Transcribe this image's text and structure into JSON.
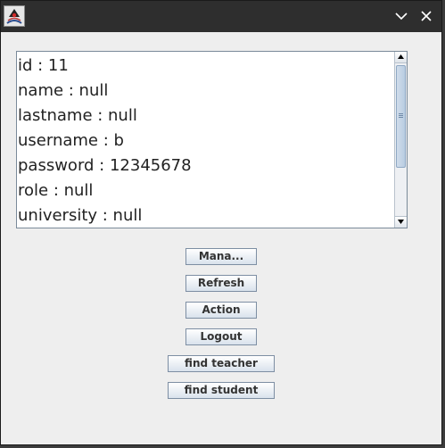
{
  "window": {
    "icons": {
      "app": "java-duke-icon",
      "minimize": "chevron-down-icon",
      "close": "close-icon"
    }
  },
  "textarea": {
    "lines": [
      "id : 11",
      "name : null",
      "lastname : null",
      "username : b",
      "password : 12345678",
      "role : null",
      "university : null"
    ]
  },
  "buttons": {
    "manage": "Mana...",
    "refresh": "Refresh",
    "action": "Action",
    "logout": "Logout",
    "find_teacher": "find teacher",
    "find_student": "find student"
  },
  "colors": {
    "titlebar": "#2e2e2e",
    "window_bg": "#eeeeee",
    "button_border": "#7d8ea3"
  }
}
